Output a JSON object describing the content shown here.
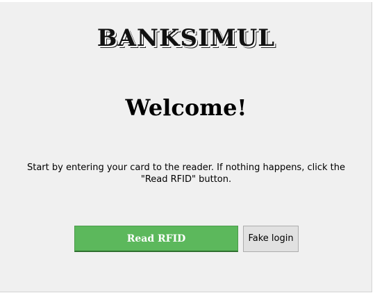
{
  "brand": {
    "title": "BANKSIMUL"
  },
  "main": {
    "heading": "Welcome!",
    "instructions": "Start by entering your card to the reader. If nothing happens, click the \"Read RFID\" button."
  },
  "actions": {
    "read_rfid_label": "Read RFID",
    "fake_login_label": "Fake login"
  },
  "colors": {
    "background": "#f0f0f0",
    "primary_button": "#5cb85c",
    "secondary_button": "#e1e1e1"
  }
}
